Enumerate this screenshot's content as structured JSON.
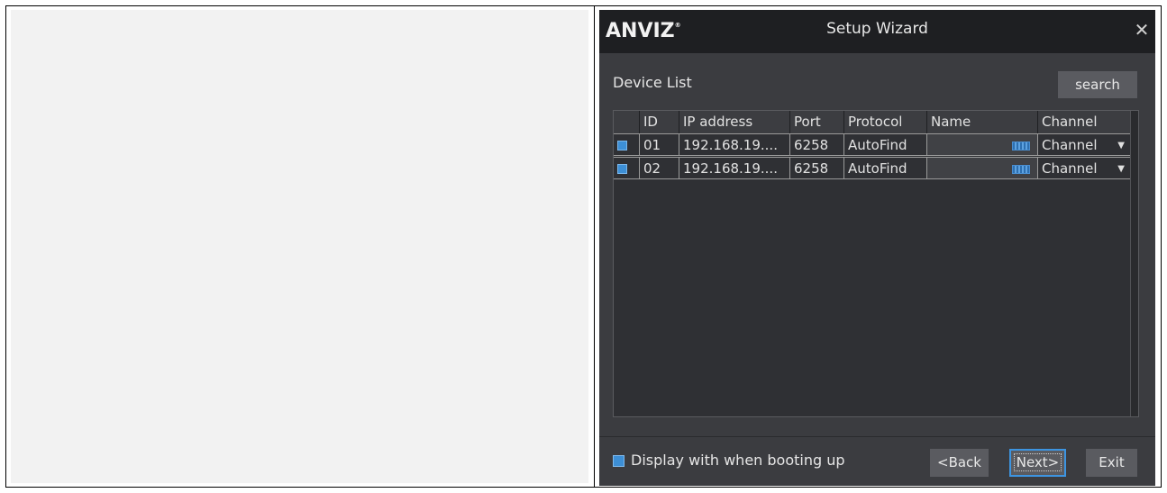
{
  "window": {
    "logo": "ANVIZ",
    "logo_mark": "®",
    "title": "Setup Wizard",
    "close_glyph": "✕"
  },
  "device_list": {
    "label": "Device List",
    "search_label": "search",
    "columns": [
      "",
      "ID",
      "IP address",
      "Port",
      "Protocol",
      "Name",
      "Channel"
    ],
    "rows": [
      {
        "checked": true,
        "id": "01",
        "ip": "192.168.19....",
        "port": "6258",
        "protocol": "AutoFind",
        "name": "",
        "channel": "Channel"
      },
      {
        "checked": true,
        "id": "02",
        "ip": "192.168.19....",
        "port": "6258",
        "protocol": "AutoFind",
        "name": "",
        "channel": "Channel"
      }
    ]
  },
  "footer": {
    "boot_checked": true,
    "boot_label": "Display with when booting up",
    "back_label": "<Back",
    "next_label": "Next>",
    "exit_label": "Exit"
  },
  "colors": {
    "dialog_bg": "#3b3c40",
    "titlebar_bg": "#1e1f22",
    "accent": "#3d8fd6",
    "button_bg": "#5a5b60"
  },
  "icons": {
    "close": "close-icon",
    "checkbox": "checkbox-icon",
    "keyboard": "keyboard-icon",
    "dropdown": "chevron-down-icon"
  }
}
